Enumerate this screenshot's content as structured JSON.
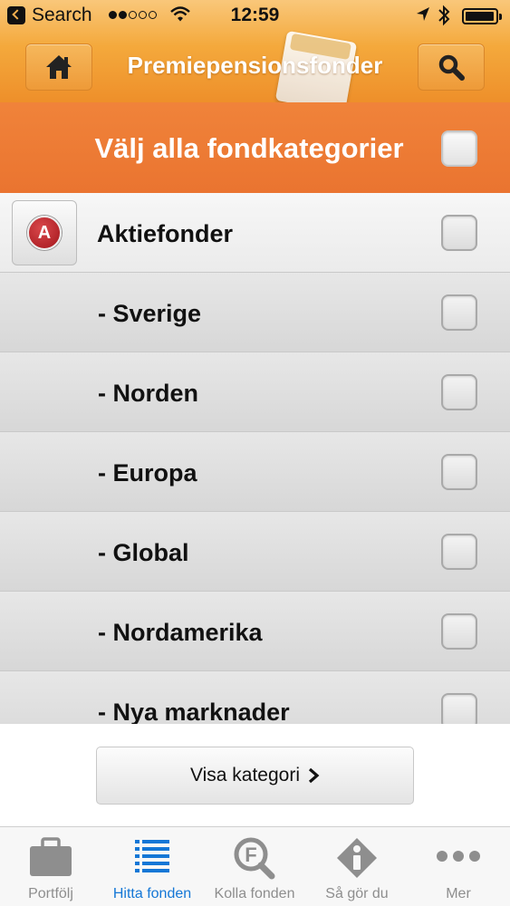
{
  "status_bar": {
    "back_label": "Search",
    "time": "12:59",
    "signal_dots": [
      true,
      true,
      false,
      false,
      false
    ]
  },
  "nav": {
    "title": "Premiepensionsfonder",
    "home_icon": "home-icon",
    "search_icon": "magnifier-icon"
  },
  "select_all": {
    "label": "Välj alla fondkategorier",
    "checked": false
  },
  "category": {
    "badge_letter": "A",
    "label": "Aktiefonder",
    "checked": false
  },
  "subcategories": [
    {
      "label": "-  Sverige",
      "checked": false
    },
    {
      "label": "-  Norden",
      "checked": false
    },
    {
      "label": "-  Europa",
      "checked": false
    },
    {
      "label": "-  Global",
      "checked": false
    },
    {
      "label": "-  Nordamerika",
      "checked": false
    },
    {
      "label": "-  Nya marknader",
      "checked": false
    }
  ],
  "action_button": {
    "label": "Visa kategori",
    "chevron": "›"
  },
  "tabs": [
    {
      "label": "Portfölj",
      "icon": "briefcase-icon",
      "active": false
    },
    {
      "label": "Hitta fonden",
      "icon": "list-icon",
      "active": true
    },
    {
      "label": "Kolla fonden",
      "icon": "fund-magnifier-icon",
      "active": false
    },
    {
      "label": "Så gör du",
      "icon": "info-diamond-icon",
      "active": false
    },
    {
      "label": "Mer",
      "icon": "more-dots-icon",
      "active": false
    }
  ],
  "colors": {
    "nav_orange": "#f4a93c",
    "select_all_orange": "#ea7430",
    "tab_active": "#1477d6",
    "tab_inactive": "#8e8e8e",
    "badge_red": "#b51c22"
  }
}
